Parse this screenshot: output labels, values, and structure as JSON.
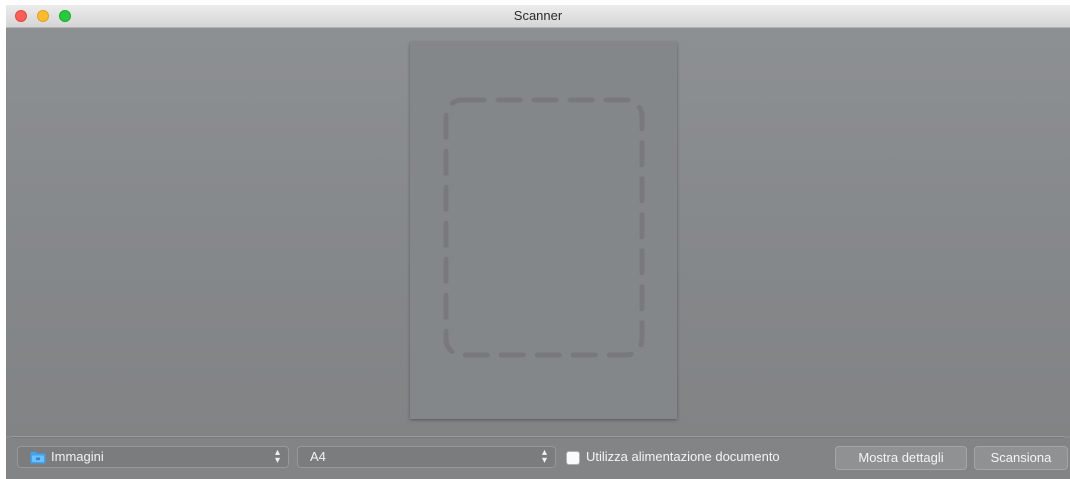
{
  "window": {
    "title": "Scanner"
  },
  "toolbar": {
    "destination": {
      "value": "Immagini",
      "icon": "folder-icon"
    },
    "size": {
      "value": "A4"
    },
    "document_feeder": {
      "label": "Utilizza alimentazione documento",
      "checked": false
    },
    "show_details_label": "Mostra dettagli",
    "scan_label": "Scansiona"
  },
  "colors": {
    "close": "#fc5f57",
    "minimize": "#fdbc2e",
    "maximize": "#28c840",
    "background": "#8a8c8e",
    "folder": "#3fa3f0"
  }
}
